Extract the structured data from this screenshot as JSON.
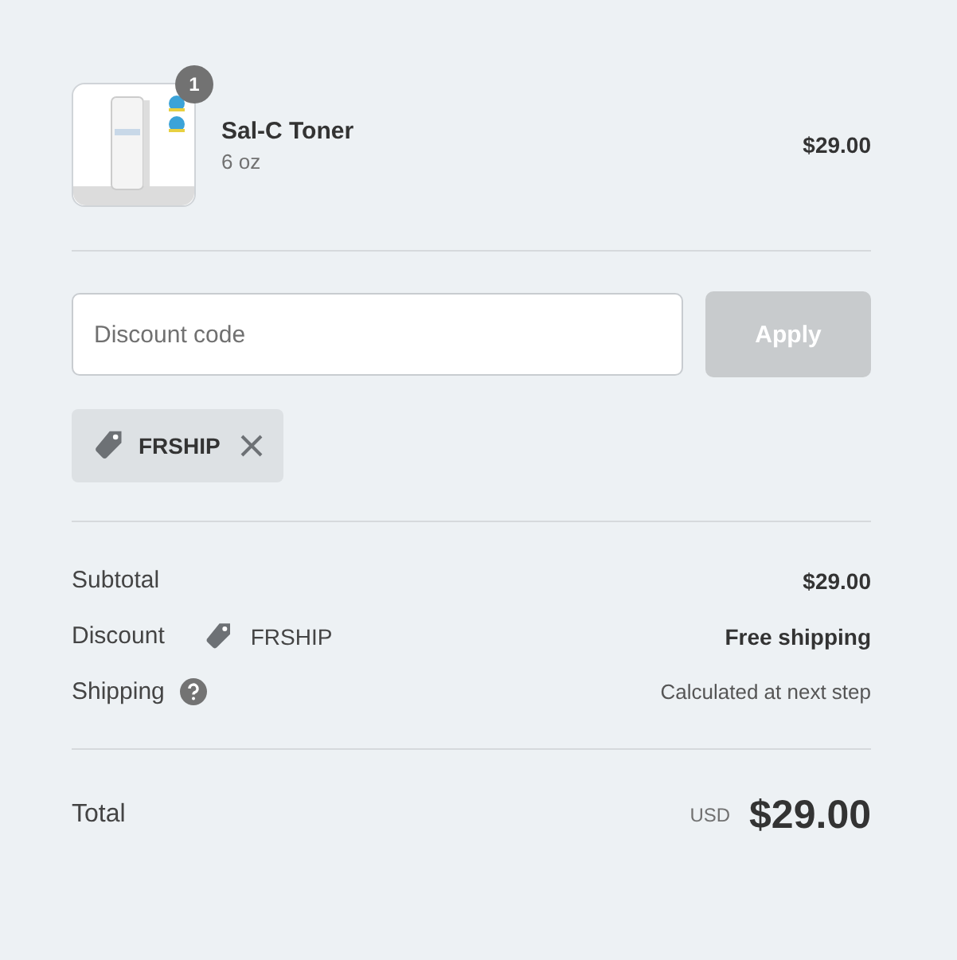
{
  "product": {
    "quantity": "1",
    "name": "Sal-C Toner",
    "variant": "6 oz",
    "price": "$29.00"
  },
  "discount": {
    "placeholder": "Discount code",
    "button": "Apply",
    "disabled": true
  },
  "applied_codes": [
    {
      "code": "FRSHIP"
    }
  ],
  "summary": [
    {
      "kind": "plain",
      "label": "Subtotal",
      "value": "$29.00"
    },
    {
      "kind": "code",
      "label": "Discount",
      "code": "FRSHIP",
      "value": "Free shipping"
    },
    {
      "kind": "help",
      "label": "Shipping",
      "value": "Calculated at next step"
    }
  ],
  "total": {
    "label": "Total",
    "currency": "USD",
    "amount": "$29.00"
  }
}
